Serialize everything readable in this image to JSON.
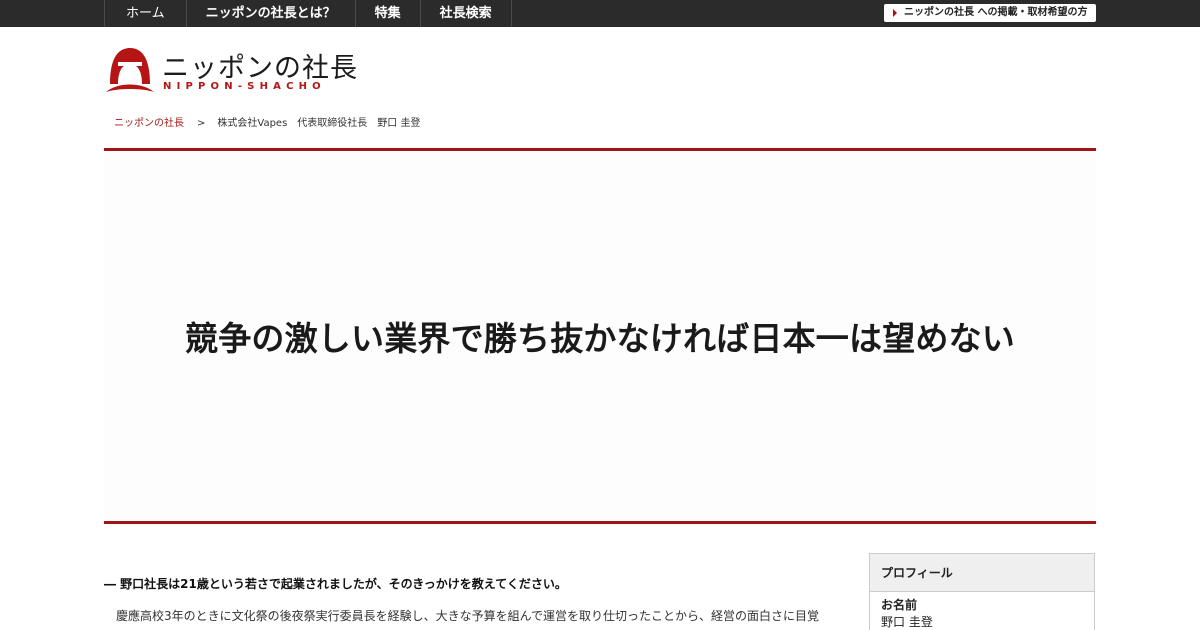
{
  "nav": {
    "items": [
      "ホーム",
      "ニッポンの社長とは？",
      "特集",
      "社長検索"
    ],
    "cta_label": "ニッポンの社長 への掲載・取材希望の方"
  },
  "logo": {
    "jp": "ニッポンの社長",
    "en": "NIPPON-SHACHO"
  },
  "breadcrumb": {
    "home": "ニッポンの社長",
    "separator": ">",
    "current": "株式会社Vapes　代表取締役社長　野口 圭登"
  },
  "hero": {
    "title": "競争の激しい業界で勝ち抜かなければ日本一は望めない"
  },
  "article": {
    "question": "― 野口社長は21歳という若さで起業されましたが、そのきっかけを教えてください。",
    "answer": "慶應高校3年のときに文化祭の後夜祭実行委員長を経験し、大きな予算を組んで運営を取り仕切ったことから、経営の面白さに目覚"
  },
  "profile": {
    "heading": "プロフィール",
    "name_label": "お名前",
    "name_value": "野口 圭登"
  },
  "colors": {
    "brand_red": "#a11414",
    "topbar": "#2b2b2b"
  }
}
